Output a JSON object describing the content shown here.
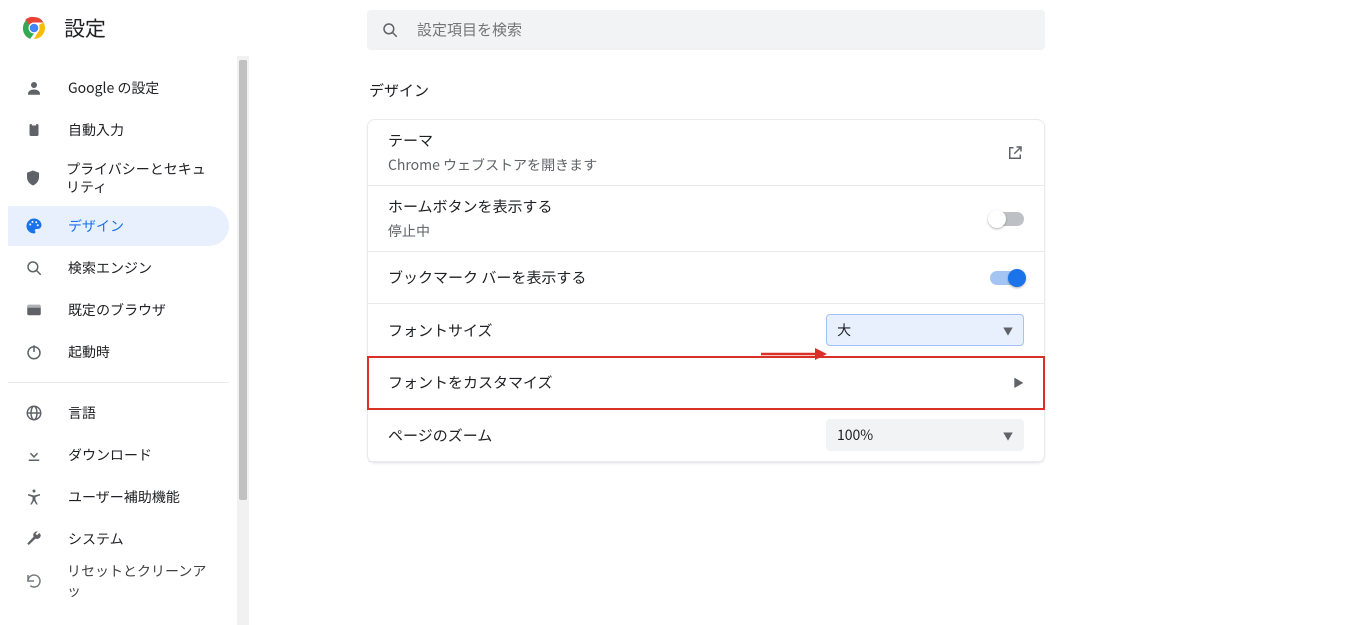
{
  "app": {
    "title": "設定"
  },
  "search": {
    "placeholder": "設定項目を検索"
  },
  "sidebar": {
    "items": [
      {
        "label": "Google の設定",
        "icon": "person"
      },
      {
        "label": "自動入力",
        "icon": "clipboard"
      },
      {
        "label": "プライバシーとセキュリティ",
        "icon": "shield"
      },
      {
        "label": "デザイン",
        "icon": "palette",
        "active": true
      },
      {
        "label": "検索エンジン",
        "icon": "search"
      },
      {
        "label": "既定のブラウザ",
        "icon": "browser"
      },
      {
        "label": "起動時",
        "icon": "power"
      }
    ],
    "items2": [
      {
        "label": "言語",
        "icon": "globe"
      },
      {
        "label": "ダウンロード",
        "icon": "download"
      },
      {
        "label": "ユーザー補助機能",
        "icon": "accessibility"
      },
      {
        "label": "システム",
        "icon": "wrench"
      },
      {
        "label": "リセットとクリーンアッ",
        "icon": "restore"
      }
    ]
  },
  "section": {
    "title": "デザイン",
    "theme": {
      "title": "テーマ",
      "sub": "Chrome ウェブストアを開きます"
    },
    "home_button": {
      "title": "ホームボタンを表示する",
      "sub": "停止中",
      "on": false
    },
    "bookmark_bar": {
      "title": "ブックマーク バーを表示する",
      "on": true
    },
    "font_size": {
      "title": "フォントサイズ",
      "value": "大"
    },
    "customize_fonts": {
      "title": "フォントをカスタマイズ"
    },
    "page_zoom": {
      "title": "ページのズーム",
      "value": "100%"
    }
  }
}
